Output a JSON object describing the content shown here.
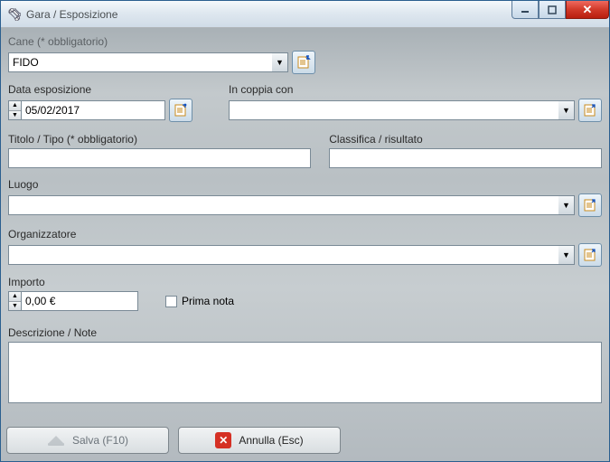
{
  "window": {
    "title": "Gara / Esposizione"
  },
  "labels": {
    "cane": "Cane (* obbligatorio)",
    "data_esposizione": "Data esposizione",
    "in_coppia_con": "In coppia con",
    "titolo_tipo": "Titolo / Tipo (* obbligatorio)",
    "classifica": "Classifica / risultato",
    "luogo": "Luogo",
    "organizzatore": "Organizzatore",
    "importo": "Importo",
    "prima_nota": "Prima nota",
    "descrizione": "Descrizione / Note"
  },
  "values": {
    "cane": "FIDO",
    "data_esposizione": "05/02/2017",
    "in_coppia_con": "",
    "titolo_tipo": "",
    "classifica": "",
    "luogo": "",
    "organizzatore": "",
    "importo": "0,00 €",
    "prima_nota_checked": false,
    "descrizione": ""
  },
  "buttons": {
    "salva": "Salva (F10)",
    "annulla": "Annulla (Esc)"
  }
}
